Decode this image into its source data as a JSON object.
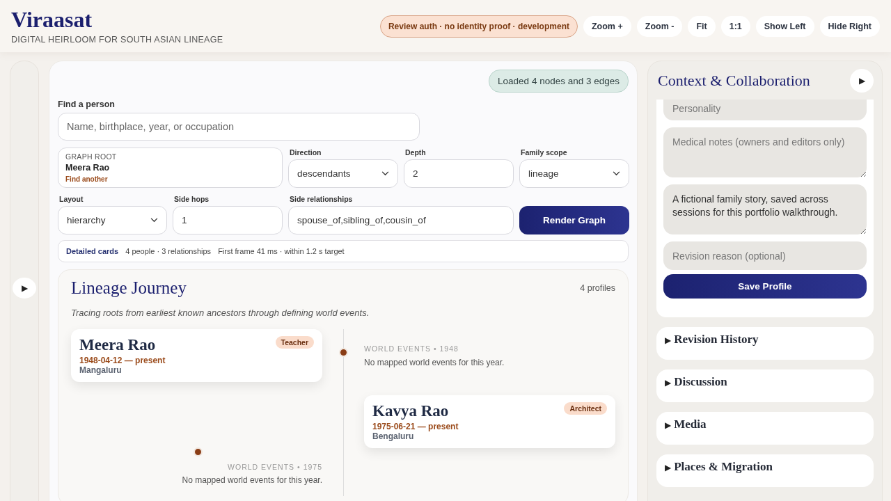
{
  "app": {
    "title": "Viraasat",
    "subtitle": "DIGITAL HEIRLOOM FOR SOUTH ASIAN LINEAGE"
  },
  "toolbar": {
    "status": "Review auth · no identity proof · development",
    "buttons": [
      "Zoom +",
      "Zoom -",
      "Fit",
      "1:1",
      "Show Left",
      "Hide Right"
    ]
  },
  "left_rail": {
    "toggle": "▶"
  },
  "graph_panel": {
    "status": "Loaded 4 nodes and 3 edges",
    "search": {
      "label": "Find a person",
      "placeholder": "Name, birthplace, year, or occupation"
    },
    "graph_root": {
      "label": "GRAPH ROOT",
      "value": "Meera Rao",
      "link": "Find another"
    },
    "controls": [
      {
        "kind": "select",
        "label": "Direction",
        "value": "descendants"
      },
      {
        "kind": "input",
        "label": "Depth",
        "value": "2"
      },
      {
        "kind": "select",
        "label": "Family scope",
        "value": "lineage"
      },
      {
        "kind": "select",
        "label": "Layout",
        "value": "hierarchy"
      },
      {
        "kind": "input",
        "label": "Side hops",
        "value": "1"
      },
      {
        "kind": "input",
        "label": "Side relationships",
        "value": "spouse_of,sibling_of,cousin_of"
      }
    ],
    "render_button": "Render Graph",
    "summary": {
      "mode": "Detailed cards",
      "counts": "4 people · 3 relationships",
      "timing": "First frame 41 ms · within 1.2 s target"
    }
  },
  "journey": {
    "title": "Lineage Journey",
    "count": "4 profiles",
    "subtitle": "Tracing roots from earliest known ancestors through defining world events.",
    "columns": [
      {
        "entries": [
          {
            "kind": "person",
            "name": "Meera Rao",
            "dates": "1948-04-12 — present",
            "place": "Mangaluru",
            "occupation": "Teacher"
          },
          {
            "kind": "event",
            "heading": "WORLD EVENTS • 1975",
            "text": "No mapped world events for this year."
          }
        ]
      },
      {
        "entries": [
          {
            "kind": "event",
            "heading": "WORLD EVENTS • 1948",
            "text": "No mapped world events for this year."
          },
          {
            "kind": "person",
            "name": "Kavya Rao",
            "dates": "1975-06-21 — present",
            "place": "Bengaluru",
            "occupation": "Architect"
          }
        ]
      }
    ]
  },
  "context_panel": {
    "title": "Context & Collaboration",
    "toggle": "▶",
    "fields": [
      {
        "kind": "input",
        "placeholder": "Personality"
      },
      {
        "kind": "textarea",
        "placeholder": "Medical notes (owners and editors only)"
      },
      {
        "kind": "textarea",
        "value": "A fictional family story, saved across sessions for this portfolio walkthrough."
      },
      {
        "kind": "input",
        "placeholder": "Revision reason (optional)"
      }
    ],
    "save_button": "Save Profile",
    "sections": [
      {
        "marker": "▶",
        "title": "Revision History",
        "expanded": false
      },
      {
        "marker": "▶",
        "title": "Discussion",
        "expanded": false
      },
      {
        "marker": "▶",
        "title": "Media",
        "expanded": false
      },
      {
        "marker": "▶",
        "title": "Places & Migration",
        "expanded": false
      }
    ]
  }
}
